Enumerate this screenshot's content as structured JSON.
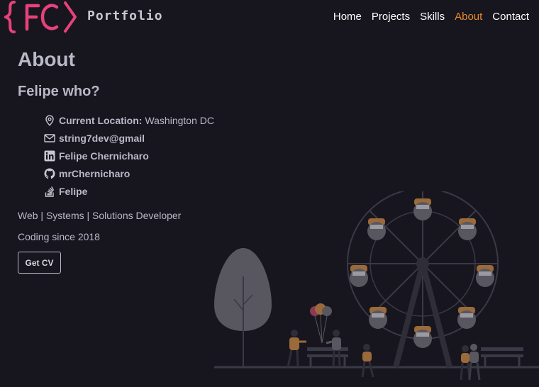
{
  "header": {
    "logo_text": "{FC}",
    "brand": "Portfolio",
    "nav": [
      {
        "label": "Home",
        "active": false
      },
      {
        "label": "Projects",
        "active": false
      },
      {
        "label": "Skills",
        "active": false
      },
      {
        "label": "About",
        "active": true
      },
      {
        "label": "Contact",
        "active": false
      }
    ]
  },
  "main": {
    "title": "About",
    "subtitle": "Felipe who?",
    "contacts": [
      {
        "icon": "location-pin-icon",
        "bold": "Current Location:",
        "text": "Washington DC"
      },
      {
        "icon": "mail-icon",
        "bold": "string7dev@gmail",
        "text": ""
      },
      {
        "icon": "linkedin-icon",
        "bold": "Felipe Chernicharo",
        "text": ""
      },
      {
        "icon": "github-icon",
        "bold": "mrChernicharo",
        "text": ""
      },
      {
        "icon": "stackoverflow-icon",
        "bold": "Felipe",
        "text": ""
      }
    ],
    "tagline": "Web | Systems | Solutions Developer",
    "since": "Coding since 2018",
    "cv_button": "Get CV"
  },
  "colors": {
    "background": "#17161f",
    "accent": "#e88a2a",
    "logo": "#e8417a",
    "text": "#b9b8c6"
  }
}
